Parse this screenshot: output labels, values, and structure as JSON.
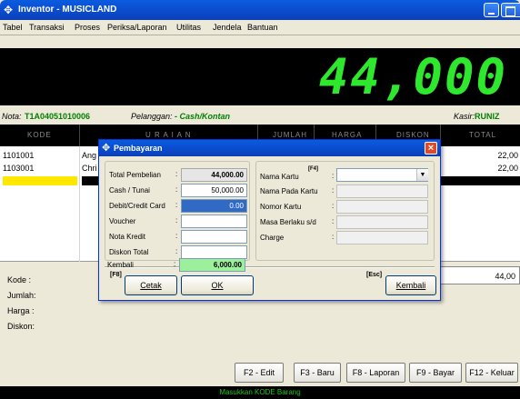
{
  "window": {
    "title": "Inventor - MUSICLAND"
  },
  "menu": [
    {
      "label": "Tabel"
    },
    {
      "label": "Transaksi"
    },
    {
      "label": "Proses"
    },
    {
      "label": "Periksa/Laporan"
    },
    {
      "label": "Utilitas"
    },
    {
      "label": "Jendela"
    },
    {
      "label": "Bantuan"
    }
  ],
  "display": {
    "amount": "44,000"
  },
  "info": {
    "nota_label": "Nota:",
    "nota_value": "T1A04051010006",
    "pelanggan_label": "Pelanggan:",
    "pelanggan_value": "- Cash/Kontan",
    "kasir_label": "Kasir:",
    "kasir_value": "RUNIZ"
  },
  "grid": {
    "columns": [
      "KODE",
      "U R A I A N",
      "JUMLAH",
      "HARGA",
      "DISKON",
      "TOTAL"
    ],
    "rows": [
      {
        "kode": "1101001",
        "uraian": "Ang",
        "total": "22,00"
      },
      {
        "kode": "1103001",
        "uraian": "Chri",
        "total": "22,00"
      }
    ]
  },
  "bottom": {
    "kode_label": "Kode  :",
    "jumlah_label": "Jumlah:",
    "harga_label": "Harga  :",
    "diskon_label": "Diskon:",
    "grand_total": "44,00"
  },
  "function_keys": [
    {
      "label": "F2 - Edit"
    },
    {
      "label": "F3 - Baru"
    },
    {
      "label": "F8 - Laporan"
    },
    {
      "label": "F9 - Bayar"
    },
    {
      "label": "F12 - Keluar"
    }
  ],
  "status": "Masukkan KODE Barang",
  "dialog": {
    "title": "Pembayaran",
    "left_fields": [
      {
        "label": "Total Pembelian",
        "value": "44,000.00"
      },
      {
        "label": "Cash / Tunai",
        "value": "50,000.00"
      },
      {
        "label": "Debit/Credit Card",
        "value": "0.00"
      },
      {
        "label": "Voucher",
        "value": ""
      },
      {
        "label": "Nota Kredit",
        "value": ""
      },
      {
        "label": "Diskon Total",
        "value": ""
      },
      {
        "label": "Kembali",
        "value": "6,000.00"
      }
    ],
    "right_fields": [
      {
        "label": "Nama Kartu",
        "value": ""
      },
      {
        "label": "Nama Pada Kartu",
        "value": ""
      },
      {
        "label": "Nomor Kartu",
        "value": ""
      },
      {
        "label": "Masa Berlaku s/d",
        "value": ""
      },
      {
        "label": "Charge",
        "value": ""
      }
    ],
    "nama_kartu_key": "[F4]",
    "colon": ":",
    "cetak_key": "[F8]",
    "cetak_label": "Cetak",
    "ok_label": "OK",
    "kembali_key": "[Esc]",
    "kembali_label": "Kembali"
  }
}
